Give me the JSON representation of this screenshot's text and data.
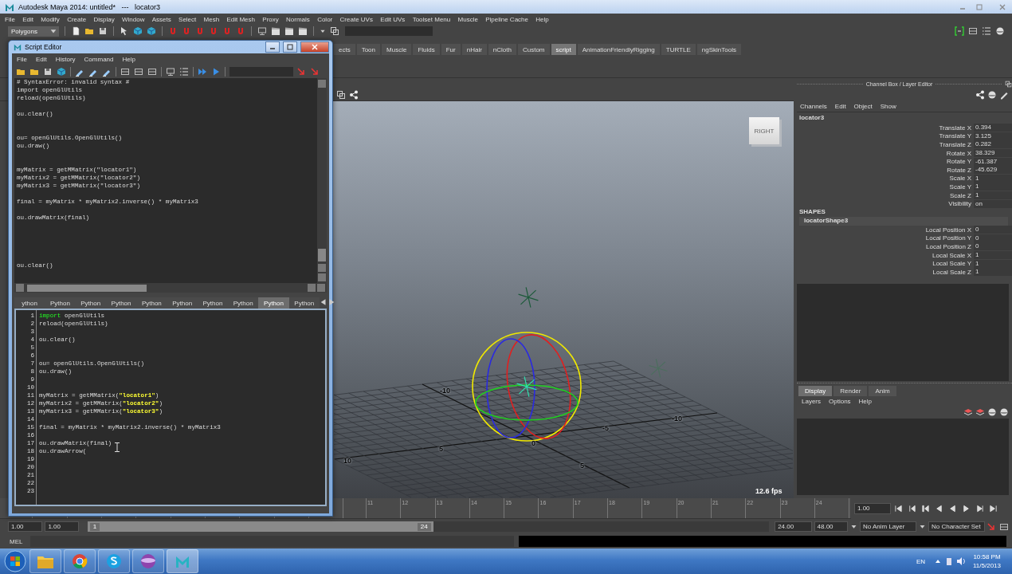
{
  "window": {
    "title": "Autodesk Maya 2014: untitled*   ---   locator3"
  },
  "menu": [
    "File",
    "Edit",
    "Modify",
    "Create",
    "Display",
    "Window",
    "Assets",
    "Select",
    "Mesh",
    "Edit Mesh",
    "Proxy",
    "Normals",
    "Color",
    "Create UVs",
    "Edit UVs",
    "Toolset Menu",
    "Muscle",
    "Pipeline Cache",
    "Help"
  ],
  "status_line": {
    "menu_set": "Polygons"
  },
  "shelf": {
    "tabs": [
      {
        "label": "ects",
        "selected": false
      },
      {
        "label": "Toon",
        "selected": false
      },
      {
        "label": "Muscle",
        "selected": false
      },
      {
        "label": "Fluids",
        "selected": false
      },
      {
        "label": "Fur",
        "selected": false
      },
      {
        "label": "nHair",
        "selected": false
      },
      {
        "label": "nCloth",
        "selected": false
      },
      {
        "label": "Custom",
        "selected": false
      },
      {
        "label": "script",
        "selected": true
      },
      {
        "label": "AnimationFriendlyRigging",
        "selected": false
      },
      {
        "label": "TURTLE",
        "selected": false
      },
      {
        "label": "ngSkinTools",
        "selected": false
      }
    ]
  },
  "viewport": {
    "view_cube": "RIGHT",
    "fps": "12.6 fps",
    "grid_labels": [
      "-10",
      "-10",
      "-5",
      "0",
      "5",
      "10",
      "5"
    ]
  },
  "channel_box": {
    "title": "Channel Box / Layer Editor",
    "menu": [
      "Channels",
      "Edit",
      "Object",
      "Show"
    ],
    "object": "locator3",
    "channels": [
      {
        "name": "Translate X",
        "value": "0.394"
      },
      {
        "name": "Translate Y",
        "value": "3.125"
      },
      {
        "name": "Translate Z",
        "value": "0.282"
      },
      {
        "name": "Rotate X",
        "value": "38.329"
      },
      {
        "name": "Rotate Y",
        "value": "-61.387"
      },
      {
        "name": "Rotate Z",
        "value": "-45.629"
      },
      {
        "name": "Scale X",
        "value": "1"
      },
      {
        "name": "Scale Y",
        "value": "1"
      },
      {
        "name": "Scale Z",
        "value": "1"
      },
      {
        "name": "Visibility",
        "value": "on"
      }
    ],
    "shapes_heading": "SHAPES",
    "shape": "locatorShape3",
    "shape_channels": [
      {
        "name": "Local Position X",
        "value": "0"
      },
      {
        "name": "Local Position Y",
        "value": "0"
      },
      {
        "name": "Local Position Z",
        "value": "0"
      },
      {
        "name": "Local Scale X",
        "value": "1"
      },
      {
        "name": "Local Scale Y",
        "value": "1"
      },
      {
        "name": "Local Scale Z",
        "value": "1"
      }
    ]
  },
  "layer_editor": {
    "tabs": [
      {
        "label": "Display",
        "selected": true
      },
      {
        "label": "Render",
        "selected": false
      },
      {
        "label": "Anim",
        "selected": false
      }
    ],
    "menu": [
      "Layers",
      "Options",
      "Help"
    ]
  },
  "time_slider": {
    "frames": [
      "11",
      "12",
      "13",
      "14",
      "15",
      "16",
      "17",
      "18",
      "19",
      "20",
      "21",
      "22",
      "23",
      "24"
    ],
    "current": "1.00"
  },
  "range_slider": {
    "level": 0.5,
    "start": "1.00",
    "playback_start": "1.00",
    "handle_start": "1",
    "handle_end": "24",
    "playback_end": "24.00",
    "end": "48.00",
    "anim_layer": "No Anim Layer",
    "character_set": "No Character Set"
  },
  "command_line": {
    "language": "MEL"
  },
  "script_editor": {
    "title": "Script Editor",
    "menu": [
      "File",
      "Edit",
      "History",
      "Command",
      "Help"
    ],
    "output": "# SyntaxError: invalid syntax #\nimport openGlUtils\nreload(openGlUtils)\n\nou.clear()\n\n\nou= openGlUtils.OpenGlUtils()\nou.draw()\n\n\nmyMatrix = getMMatrix(\"locator1\")\nmyMatrix2 = getMMatrix(\"locator2\")\nmyMatrix3 = getMMatrix(\"locator3\")\n\nfinal = myMatrix * myMatrix2.inverse() * myMatrix3\n\nou.drawMatrix(final)\n\n\n\n\n\nou.clear()",
    "tabs": [
      {
        "label": "ython",
        "selected": false
      },
      {
        "label": "Python",
        "selected": false
      },
      {
        "label": "Python",
        "selected": false
      },
      {
        "label": "Python",
        "selected": false
      },
      {
        "label": "Python",
        "selected": false
      },
      {
        "label": "Python",
        "selected": false
      },
      {
        "label": "Python",
        "selected": false
      },
      {
        "label": "Python",
        "selected": false
      },
      {
        "label": "Python",
        "selected": true
      },
      {
        "label": "Python",
        "selected": false
      }
    ],
    "input": [
      {
        "number": "1",
        "segments": [
          {
            "kind": "keyword",
            "text": "import"
          },
          {
            "kind": "plain",
            "text": " openGlUtils"
          }
        ]
      },
      {
        "number": "2",
        "code": "reload(openGlUtils)"
      },
      {
        "number": "3"
      },
      {
        "number": "4",
        "code": "ou.clear()"
      },
      {
        "number": "5"
      },
      {
        "number": "6"
      },
      {
        "number": "7",
        "code": "ou= openGlUtils.OpenGlUtils()"
      },
      {
        "number": "8",
        "code": "ou.draw()"
      },
      {
        "number": "9"
      },
      {
        "number": "10"
      },
      {
        "number": "11",
        "segments": [
          {
            "kind": "plain",
            "text": "myMatrix = getMMatrix("
          },
          {
            "kind": "string",
            "text": "\"locator1\""
          },
          {
            "kind": "plain",
            "text": ")"
          }
        ]
      },
      {
        "number": "12",
        "segments": [
          {
            "kind": "plain",
            "text": "myMatrix2 = getMMatrix("
          },
          {
            "kind": "string",
            "text": "\"locator2\""
          },
          {
            "kind": "plain",
            "text": ")"
          }
        ]
      },
      {
        "number": "13",
        "segments": [
          {
            "kind": "plain",
            "text": "myMatrix3 = getMMatrix("
          },
          {
            "kind": "string",
            "text": "\"locator3\""
          },
          {
            "kind": "plain",
            "text": ")"
          }
        ]
      },
      {
        "number": "14"
      },
      {
        "number": "15",
        "code": "final = myMatrix * myMatrix2.inverse() * myMatrix3"
      },
      {
        "number": "16"
      },
      {
        "number": "17",
        "code": "ou.drawMatrix(final)"
      },
      {
        "number": "18",
        "code": "ou.drawArrow("
      },
      {
        "number": "19"
      },
      {
        "number": "20"
      },
      {
        "number": "21"
      },
      {
        "number": "22"
      },
      {
        "number": "23"
      }
    ]
  },
  "taskbar": {
    "language": "EN",
    "time": "10:58 PM",
    "date": "11/5/2013"
  }
}
